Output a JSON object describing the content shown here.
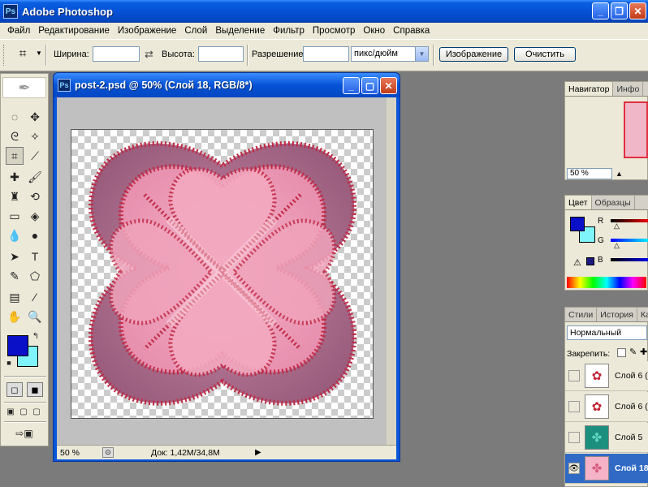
{
  "app": {
    "title": "Adobe Photoshop",
    "icon": "photoshop-icon"
  },
  "menu": [
    "Файл",
    "Редактирование",
    "Изображение",
    "Слой",
    "Выделение",
    "Фильтр",
    "Просмотр",
    "Окно",
    "Справка"
  ],
  "options": {
    "width_label": "Ширина:",
    "width_value": "",
    "height_label": "Высота:",
    "height_value": "",
    "resolution_label": "Разрешение:",
    "resolution_value": "",
    "units": "пикс/дюйм",
    "image_button": "Изображение",
    "clear_button": "Очистить"
  },
  "document": {
    "title": "post-2.psd @ 50% (Слой 18, RGB/8*)",
    "zoom": "50 %",
    "doc_info": "Док: 1,42M/34,8M"
  },
  "navigator": {
    "tabs": [
      "Навигатор",
      "Инфо"
    ],
    "zoom": "50 %"
  },
  "color_panel": {
    "tabs": [
      "Цвет",
      "Образцы"
    ],
    "channels": [
      "R",
      "G",
      "B"
    ],
    "foreground": "#0a0fc8",
    "background": "#7ff4fb"
  },
  "layers_panel": {
    "tabs": [
      "Стили",
      "История",
      "Ка"
    ],
    "blend_mode": "Нормальный",
    "lock_label": "Закрепить:",
    "layers": [
      {
        "name": "Слой 6 (",
        "visible": false,
        "thumb": "rose-icon"
      },
      {
        "name": "Слой 6 (",
        "visible": false,
        "thumb": "rose-icon"
      },
      {
        "name": "Слой 5",
        "visible": false,
        "thumb": "teal-flower-icon"
      },
      {
        "name": "Слой 18",
        "visible": true,
        "selected": true,
        "thumb": "pink-flower-icon"
      }
    ]
  }
}
